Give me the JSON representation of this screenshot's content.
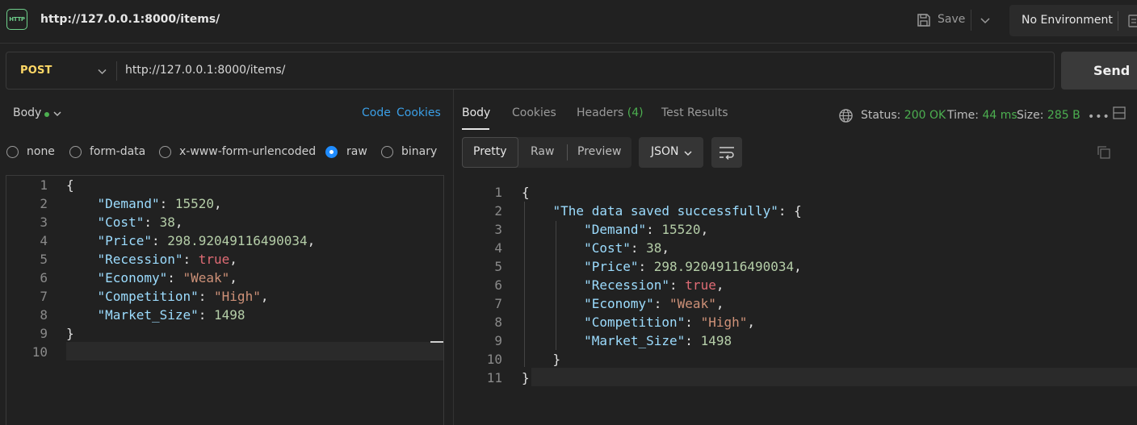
{
  "header": {
    "http_icon_text": "HTTP",
    "request_title": "http://127.0.0.1:8000/items/",
    "save_label": "Save",
    "environment": "No Environment"
  },
  "request": {
    "method": "POST",
    "url": "http://127.0.0.1:8000/items/",
    "send_label": "Send"
  },
  "left_pane": {
    "body_tab": "Body",
    "code_link": "Code",
    "cookies_link": "Cookies",
    "body_types": [
      "none",
      "form-data",
      "x-www-form-urlencoded",
      "raw",
      "binary"
    ],
    "selected_body_type": "raw",
    "editor_lines": [
      "{",
      "    \"Demand\": 15520,",
      "    \"Cost\": 38,",
      "    \"Price\": 298.92049116490034,",
      "    \"Recession\": true,",
      "    \"Economy\": \"Weak\",",
      "    \"Competition\": \"High\",",
      "    \"Market_Size\": 1498",
      "}",
      ""
    ],
    "line_numbers": [
      "1",
      "2",
      "3",
      "4",
      "5",
      "6",
      "7",
      "8",
      "9",
      "10"
    ]
  },
  "right_pane": {
    "tabs": [
      "Body",
      "Cookies",
      "Headers",
      "Test Results"
    ],
    "headers_count": "(4)",
    "status_label": "Status:",
    "status_value": "200 OK",
    "time_label": "Time:",
    "time_value": "44 ms",
    "size_label": "Size:",
    "size_value": "285 B",
    "more_label": "•••",
    "view_modes": [
      "Pretty",
      "Raw",
      "Preview"
    ],
    "format": "JSON",
    "response_lines": [
      "{",
      "    \"The data saved successfully\": {",
      "        \"Demand\": 15520,",
      "        \"Cost\": 38,",
      "        \"Price\": 298.92049116490034,",
      "        \"Recession\": true,",
      "        \"Economy\": \"Weak\",",
      "        \"Competition\": \"High\",",
      "        \"Market_Size\": 1498",
      "    }",
      "}"
    ],
    "line_numbers": [
      "1",
      "2",
      "3",
      "4",
      "5",
      "6",
      "7",
      "8",
      "9",
      "10",
      "11"
    ]
  },
  "colors": {
    "background": "#212121",
    "method": "#ffd866",
    "link": "#3b9fe6",
    "success": "#4caf50",
    "json_key": "#9cdcfe",
    "json_string": "#ce9178",
    "json_number": "#b5cea8",
    "json_boolean": "#e06c75"
  }
}
